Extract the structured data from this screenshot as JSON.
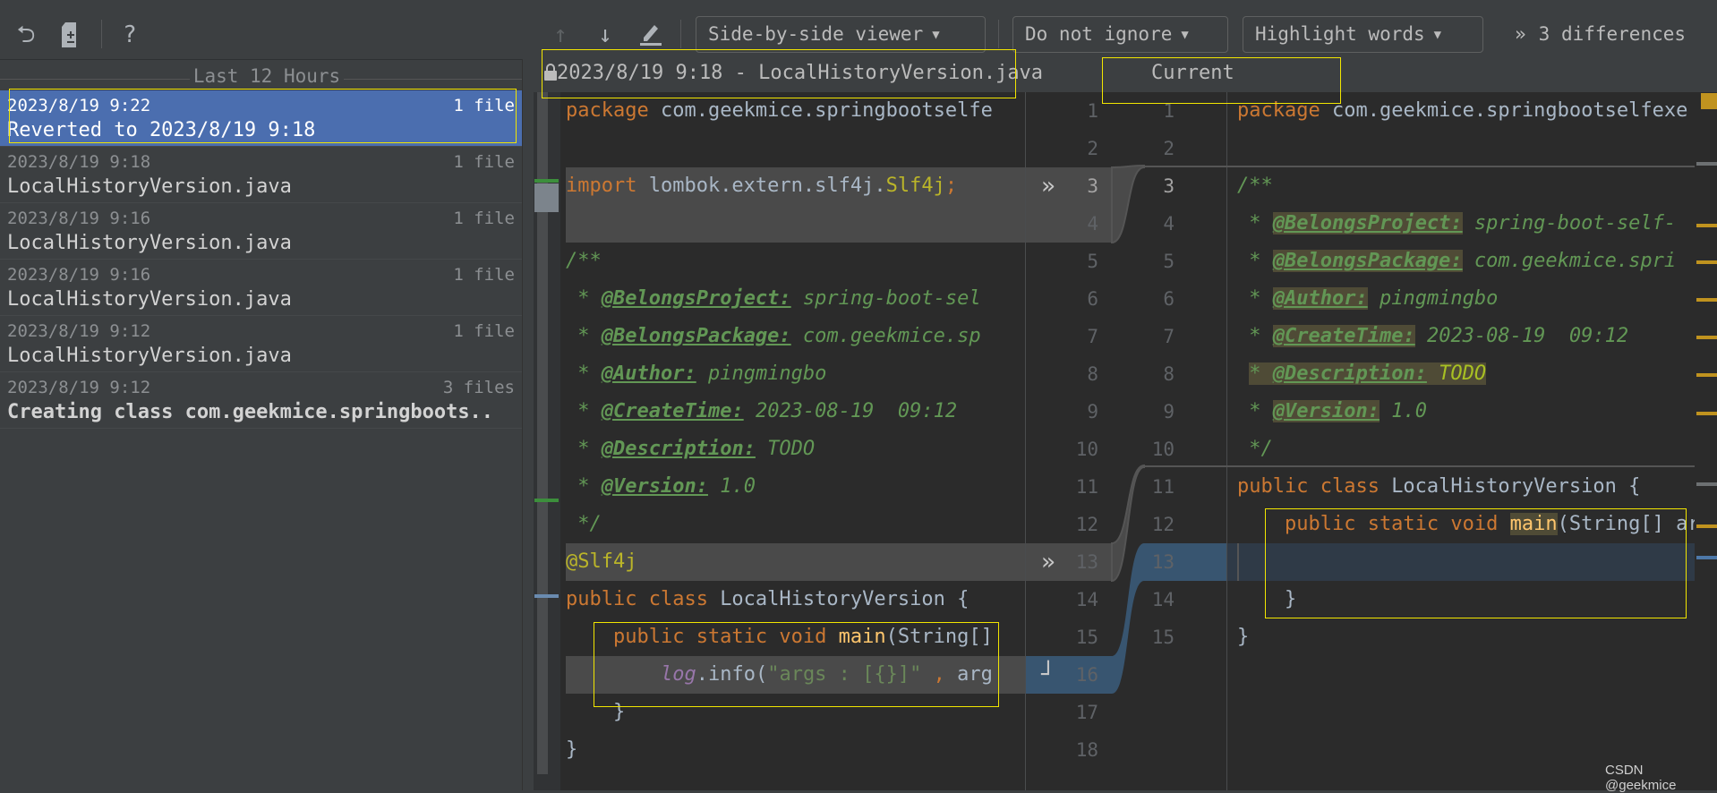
{
  "toolbar": {
    "left_icons": [
      "revert-icon",
      "patch-icon",
      "help-icon"
    ],
    "help_label": "?",
    "nav_icons": [
      "arrow-up-icon",
      "arrow-down-icon",
      "edit-icon"
    ],
    "viewer_dropdown": "Side-by-side viewer",
    "ignore_dropdown": "Do not ignore",
    "highlight_dropdown": "Highlight words",
    "differences": "3 differences",
    "differences_prefix": "»"
  },
  "history": {
    "group_label": "Last 12 Hours",
    "items": [
      {
        "date": "2023/8/19 9:22",
        "count": "1 file",
        "name": "Reverted to 2023/8/19 9:18",
        "selected": true
      },
      {
        "date": "2023/8/19 9:18",
        "count": "1 file",
        "name": "LocalHistoryVersion.java"
      },
      {
        "date": "2023/8/19 9:16",
        "count": "1 file",
        "name": "LocalHistoryVersion.java"
      },
      {
        "date": "2023/8/19 9:16",
        "count": "1 file",
        "name": "LocalHistoryVersion.java"
      },
      {
        "date": "2023/8/19 9:12",
        "count": "1 file",
        "name": "LocalHistoryVersion.java"
      },
      {
        "date": "2023/8/19 9:12",
        "count": "3 files",
        "name": "Creating class com.geekmice.springboots..",
        "bold": true
      }
    ]
  },
  "editor": {
    "left_title": "2023/8/19 9:18 - LocalHistoryVersion.java",
    "right_title": "Current",
    "colors": {
      "deleted": "#4a4a4a",
      "modified": "#385570",
      "highlight": "#4f4b36",
      "selection": "#4b6eaf"
    },
    "left": {
      "lines": [
        {
          "n": "1",
          "tokens": [
            [
              "kw",
              "package "
            ],
            [
              "id",
              "com.geekmice.springbootselfe"
            ]
          ]
        },
        {
          "n": "2",
          "tokens": []
        },
        {
          "n": "3",
          "tokens": [
            [
              "kw",
              "import "
            ],
            [
              "id",
              "lombok.extern.slf4j."
            ],
            [
              "ann",
              "Slf4j"
            ],
            [
              "kw",
              ";"
            ]
          ],
          "change": "deleted",
          "marker": "double-chevron-right-icon"
        },
        {
          "n": "4",
          "tokens": [],
          "change": "deleted"
        },
        {
          "n": "5",
          "tokens": [
            [
              "doc",
              "/**"
            ]
          ]
        },
        {
          "n": "6",
          "tokens": [
            [
              "doc",
              " * "
            ],
            [
              "tag",
              "@BelongsProject:"
            ],
            [
              "doc",
              " spring-boot-sel"
            ]
          ]
        },
        {
          "n": "7",
          "tokens": [
            [
              "doc",
              " * "
            ],
            [
              "tag",
              "@BelongsPackage:"
            ],
            [
              "doc",
              " com.geekmice.sp"
            ]
          ]
        },
        {
          "n": "8",
          "tokens": [
            [
              "doc",
              " * "
            ],
            [
              "tag",
              "@Author:"
            ],
            [
              "doc",
              " pingmingbo"
            ]
          ]
        },
        {
          "n": "9",
          "tokens": [
            [
              "doc",
              " * "
            ],
            [
              "tag",
              "@CreateTime:"
            ],
            [
              "doc",
              " 2023-08-19  09:12"
            ]
          ]
        },
        {
          "n": "10",
          "tokens": [
            [
              "doc",
              " * "
            ],
            [
              "tag",
              "@Description:"
            ],
            [
              "doc",
              " TODO"
            ]
          ]
        },
        {
          "n": "11",
          "tokens": [
            [
              "doc",
              " * "
            ],
            [
              "tag",
              "@Version:"
            ],
            [
              "doc",
              " 1.0"
            ]
          ]
        },
        {
          "n": "12",
          "tokens": [
            [
              "doc",
              " */"
            ]
          ]
        },
        {
          "n": "13",
          "tokens": [
            [
              "ann",
              "@Slf4j"
            ]
          ],
          "change": "deleted",
          "marker": "double-chevron-right-icon"
        },
        {
          "n": "14",
          "tokens": [
            [
              "kw",
              "public class "
            ],
            [
              "id",
              "LocalHistoryVersion {"
            ]
          ]
        },
        {
          "n": "15",
          "tokens": [
            [
              "kw",
              "    public static void "
            ],
            [
              "fn",
              "main"
            ],
            [
              "id",
              "(String[]"
            ]
          ]
        },
        {
          "n": "16",
          "tokens": [
            [
              "id",
              "        "
            ],
            [
              "log",
              "log"
            ],
            [
              "id",
              ".info("
            ],
            [
              "str",
              "\"args : [{}]\""
            ],
            [
              "kw",
              " , "
            ],
            [
              "id",
              "arg"
            ]
          ],
          "change": "modified",
          "marker": "apply-icon"
        },
        {
          "n": "17",
          "tokens": [
            [
              "id",
              "    }"
            ]
          ]
        },
        {
          "n": "18",
          "tokens": [
            [
              "id",
              "}"
            ]
          ]
        }
      ]
    },
    "right": {
      "lines": [
        {
          "n": "1",
          "tokens": [
            [
              "kw",
              "package "
            ],
            [
              "id",
              "com.geekmice.springbootselfexe"
            ]
          ]
        },
        {
          "n": "2",
          "tokens": []
        },
        {
          "n": "3",
          "tokens": [
            [
              "doc",
              "/**"
            ]
          ],
          "current": true
        },
        {
          "n": "4",
          "tokens": [
            [
              "doc",
              " * "
            ],
            [
              "tag",
              "@BelongsProject:",
              "hl"
            ],
            [
              "doc",
              " spring-boot-self-"
            ]
          ]
        },
        {
          "n": "5",
          "tokens": [
            [
              "doc",
              " * "
            ],
            [
              "tag",
              "@BelongsPackage:",
              "hl"
            ],
            [
              "doc",
              " com.geekmice.spri"
            ]
          ]
        },
        {
          "n": "6",
          "tokens": [
            [
              "doc",
              " * "
            ],
            [
              "tag",
              "@Author:",
              "hl"
            ],
            [
              "doc",
              " pingmingbo"
            ]
          ]
        },
        {
          "n": "7",
          "tokens": [
            [
              "doc",
              " * "
            ],
            [
              "tag",
              "@CreateTime:",
              "hl"
            ],
            [
              "doc",
              " 2023-08-19  09:12"
            ]
          ]
        },
        {
          "n": "8",
          "tokens": [
            [
              "doc",
              " "
            ],
            [
              "doc",
              "* ",
              "hl"
            ],
            [
              "tag",
              "@Description:",
              "hl"
            ],
            [
              "todo",
              " TODO",
              "hl"
            ]
          ]
        },
        {
          "n": "9",
          "tokens": [
            [
              "doc",
              " * "
            ],
            [
              "tag",
              "@Version:",
              "hl"
            ],
            [
              "doc",
              " 1.0"
            ]
          ]
        },
        {
          "n": "10",
          "tokens": [
            [
              "doc",
              " */"
            ]
          ]
        },
        {
          "n": "11",
          "tokens": [
            [
              "kw",
              "public class "
            ],
            [
              "id",
              "LocalHistoryVersion {"
            ]
          ]
        },
        {
          "n": "12",
          "tokens": [
            [
              "kw",
              "    public static void "
            ],
            [
              "fn",
              "main",
              "hl"
            ],
            [
              "id",
              "(String[] ar"
            ]
          ]
        },
        {
          "n": "13",
          "tokens": [],
          "change": "modified"
        },
        {
          "n": "14",
          "tokens": [
            [
              "id",
              "    }"
            ]
          ]
        },
        {
          "n": "15",
          "tokens": [
            [
              "id",
              "}"
            ]
          ]
        }
      ]
    }
  },
  "watermark": "CSDN @geekmice"
}
